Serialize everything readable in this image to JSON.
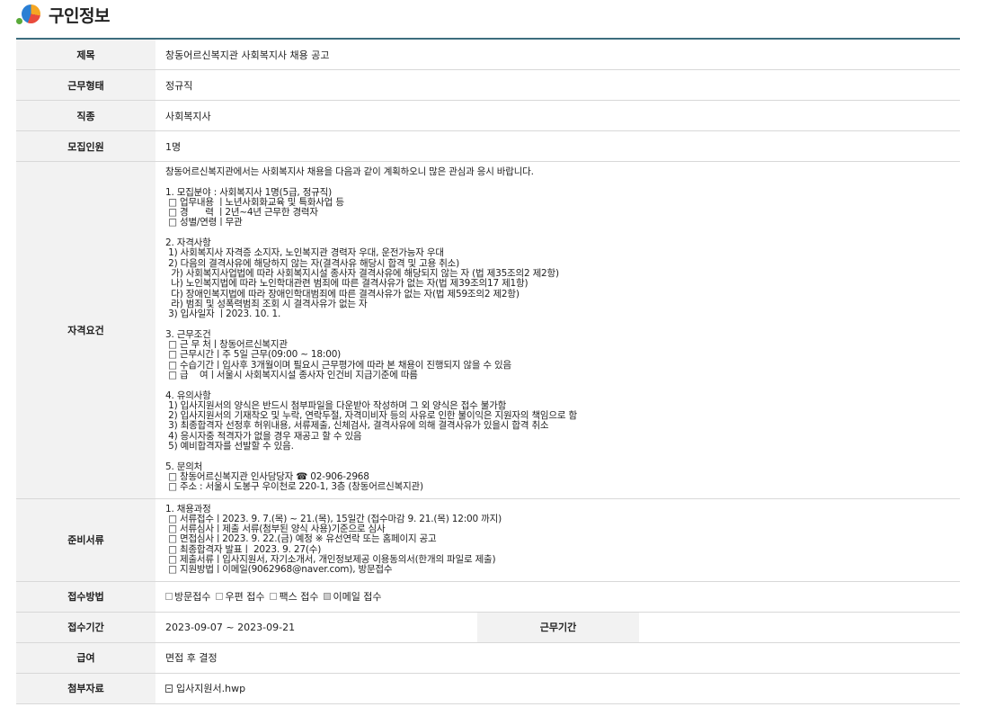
{
  "page": {
    "title": "구인정보"
  },
  "rows": {
    "title": {
      "label": "제목",
      "value": "창동어르신복지관 사회복지사 채용 공고"
    },
    "work_type": {
      "label": "근무형태",
      "value": "정규직"
    },
    "job": {
      "label": "직종",
      "value": "사회복지사"
    },
    "headcount": {
      "label": "모집인원",
      "value": "1명"
    },
    "requirements": {
      "label": "자격요건",
      "text": "창동어르신복지관에서는 사회복지사 채용을 다음과 같이 계획하오니 많은 관심과 응시 바랍니다.\n\n1. 모집분야 : 사회복지사 1명(5급, 정규직)\n □ 업무내용 ㅣ노년사회화교육 및 특화사업 등\n □ 경      력 ㅣ2년~4년 근무한 경력자\n □ 성별/연령ㅣ무관\n\n2. 자격사항\n 1) 사회복지사 자격증 소지자, 노인복지관 경력자 우대, 운전가능자 우대\n 2) 다음의 결격사유에 해당하지 않는 자(결격사유 해당시 합격 및 고용 취소)\n  가) 사회복지사업법에 따라 사회복지시설 종사자 결격사유에 해당되지 않는 자 (법 제35조의2 제2항)\n  나) 노인복지법에 따라 노인학대관련 범죄에 따른 결격사유가 없는 자(법 제39조의17 제1항)\n  다) 장애인복지법에 따라 장애인학대범죄에 따른 결격사유가 없는 자(법 제59조의2 제2항)\n  라) 범죄 및 성폭력범죄 조회 시 결격사유가 없는 자\n 3) 입사일자 ㅣ2023. 10. 1.\n\n3. 근무조건\n □ 근 무 처ㅣ창동어르신복지관\n □ 근무시간ㅣ주 5일 근무(09:00 ~ 18:00)\n □ 수습기간ㅣ입사후 3개월이며 필요시 근무평가에 따라 본 채용이 진행되지 않을 수 있음\n □ 급    여ㅣ서울시 사회복지시설 종사자 인건비 지급기준에 따름\n\n4. 유의사항\n 1) 입사지원서의 양식은 반드시 첨부파일을 다운받아 작성하며 그 외 양식은 접수 불가함\n 2) 입사지원서의 기재착오 및 누락, 연락두절, 자격미비자 등의 사유로 인한 불이익은 지원자의 책임으로 함\n 3) 최종합격자 선정후 허위내용, 서류제출, 신체검사, 결격사유에 의해 결격사유가 있을시 합격 취소\n 4) 응시자중 적격자가 없을 경우 재공고 할 수 있음\n 5) 예비합격자를 선발할 수 있음.\n\n5. 문의처\n □ 창동어르신복지관 인사담당자 ☎ 02-906-2968\n □ 주소 : 서울시 도봉구 우이천로 220-1, 3층 (창동어르신복지관)"
    },
    "documents": {
      "label": "준비서류",
      "text": "1. 채용과정\n □ 서류접수ㅣ2023. 9. 7.(목) ~ 21.(목), 15일간 (접수마감 9. 21.(목) 12:00 까지)\n □ 서류심사ㅣ제출 서류(첨부된 양식 사용)기준으로 심사\n □ 면접심사ㅣ2023. 9. 22.(금) 예정 ※ 유선연락 또는 홈페이지 공고\n □ 최종합격자 발표ㅣ 2023. 9. 27(수)\n □ 제출서류ㅣ입사지원서, 자기소개서, 개인정보제공 이용동의서(한개의 파일로 제출)\n □ 지원방법ㅣ이메일(9062968@naver.com), 방문접수"
    },
    "apply_method": {
      "label": "접수방법",
      "options": [
        {
          "label": "방문접수",
          "checked": false
        },
        {
          "label": "우편 접수",
          "checked": false
        },
        {
          "label": "팩스 접수",
          "checked": false
        },
        {
          "label": "이메일 접수",
          "checked": true
        }
      ]
    },
    "apply_period": {
      "label": "접수기간",
      "value": "2023-09-07 ~ 2023-09-21",
      "work_period_label": "근무기간",
      "work_period_value": ""
    },
    "salary": {
      "label": "급여",
      "value": "면접 후 결정"
    },
    "attachment": {
      "label": "첨부자료",
      "file": "입사지원서.hwp"
    }
  }
}
